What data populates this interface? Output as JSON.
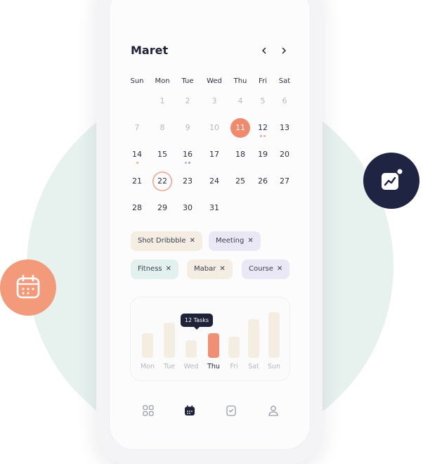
{
  "calendar": {
    "month": "Maret",
    "prev_icon": "chevron-left-icon",
    "next_icon": "chevron-right-icon",
    "weekdays": [
      "Sun",
      "Mon",
      "Tue",
      "Wed",
      "Thu",
      "Fri",
      "Sat"
    ],
    "days": [
      "1",
      "2",
      "3",
      "4",
      "5",
      "6",
      "7",
      "8",
      "9",
      "10",
      "11",
      "12",
      "13",
      "14",
      "15",
      "16",
      "17",
      "18",
      "19",
      "20",
      "21",
      "22",
      "23",
      "24",
      "25",
      "26",
      "27",
      "28",
      "29",
      "30",
      "31"
    ],
    "dimmed_through": 10,
    "selected_day": "11",
    "today_day": "22",
    "event_dots": [
      {
        "day": "12",
        "colors": [
          "#b6aee6",
          "#f3b27a"
        ]
      },
      {
        "day": "14",
        "colors": [
          "#f3b27a"
        ]
      },
      {
        "day": "16",
        "colors": [
          "#b6aee6",
          "#9aa0b8"
        ]
      }
    ],
    "selected_color": "#f08a6c"
  },
  "tags": [
    {
      "label": "Shot Dribbble",
      "bg": "#f3ede2"
    },
    {
      "label": "Meeting",
      "bg": "#ebe8f6"
    },
    {
      "label": "Fitness",
      "bg": "#e3f1ee"
    },
    {
      "label": "Mabar",
      "bg": "#f3ede2"
    },
    {
      "label": "Course",
      "bg": "#ebe8f6"
    }
  ],
  "chart_data": {
    "type": "bar",
    "categories": [
      "Mon",
      "Tue",
      "Wed",
      "Thu",
      "Fri",
      "Sat",
      "Sun"
    ],
    "values": [
      7,
      10,
      5,
      7,
      6,
      11,
      13
    ],
    "highlighted": "Thu",
    "tooltip": "12 Tasks",
    "ylim": [
      0,
      14
    ]
  },
  "bottom_nav": [
    "grid-icon",
    "calendar-icon",
    "notes-icon",
    "profile-icon"
  ],
  "fabs": {
    "left": "calendar-icon",
    "right": "trending-chart-icon"
  },
  "colors": {
    "accent": "#f08a6c",
    "dark": "#1f2238",
    "mint": "#e7f1ee"
  }
}
